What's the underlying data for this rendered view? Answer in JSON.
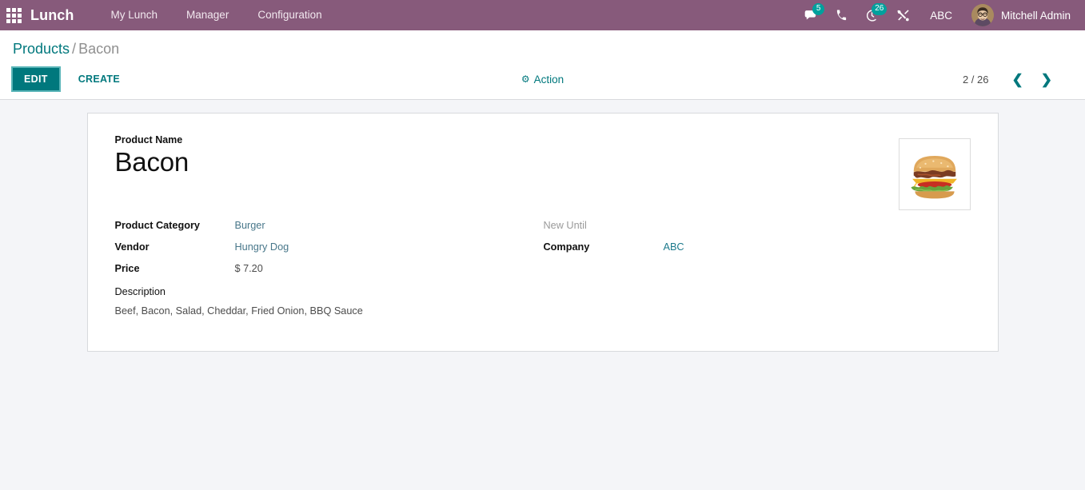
{
  "navbar": {
    "apps_icon": "apps-grid-icon",
    "brand": "Lunch",
    "menus": [
      {
        "label": "My Lunch"
      },
      {
        "label": "Manager"
      },
      {
        "label": "Configuration"
      }
    ],
    "systray": {
      "messaging": {
        "icon": "chat-bubble-icon",
        "badge": "5"
      },
      "voip": {
        "icon": "phone-icon",
        "badge": ""
      },
      "activities": {
        "icon": "clock-activity-icon",
        "badge": "26"
      },
      "debug": {
        "icon": "tools-wrench-icon"
      },
      "company": {
        "label": "ABC"
      },
      "user": {
        "name": "Mitchell Admin",
        "avatar": "user-avatar-image"
      }
    }
  },
  "control_panel": {
    "breadcrumb": {
      "parent": "Products",
      "separator": "/",
      "current": "Bacon"
    },
    "buttons": {
      "edit": "EDIT",
      "create": "CREATE"
    },
    "action_menu": {
      "icon": "gear-icon",
      "glyph": "⚙",
      "label": "Action"
    },
    "pager": {
      "count": "2 / 26",
      "prev_glyph": "❮",
      "next_glyph": "❯"
    }
  },
  "form": {
    "title_label": "Product Name",
    "title_value": "Bacon",
    "image_alt": "product-image-burger",
    "left_fields": [
      {
        "label": "Product Category",
        "value": "Burger",
        "style": "link"
      },
      {
        "label": "Vendor",
        "value": "Hungry Dog",
        "style": "link"
      },
      {
        "label": "Price",
        "value": "$ 7.20",
        "style": "plain"
      }
    ],
    "right_fields": [
      {
        "label": "New Until",
        "value": "",
        "style": "empty"
      },
      {
        "label": "Company",
        "value": "ABC",
        "style": "teal"
      }
    ],
    "description_label": "Description",
    "description_value": "Beef, Bacon, Salad, Cheddar, Fried Onion, BBQ Sauce"
  },
  "colors": {
    "brand_purple": "#875A7B",
    "accent_teal": "#00787d",
    "badge_teal": "#00A09D",
    "page_bg": "#f4f5f8",
    "link_slate": "#48778a"
  }
}
